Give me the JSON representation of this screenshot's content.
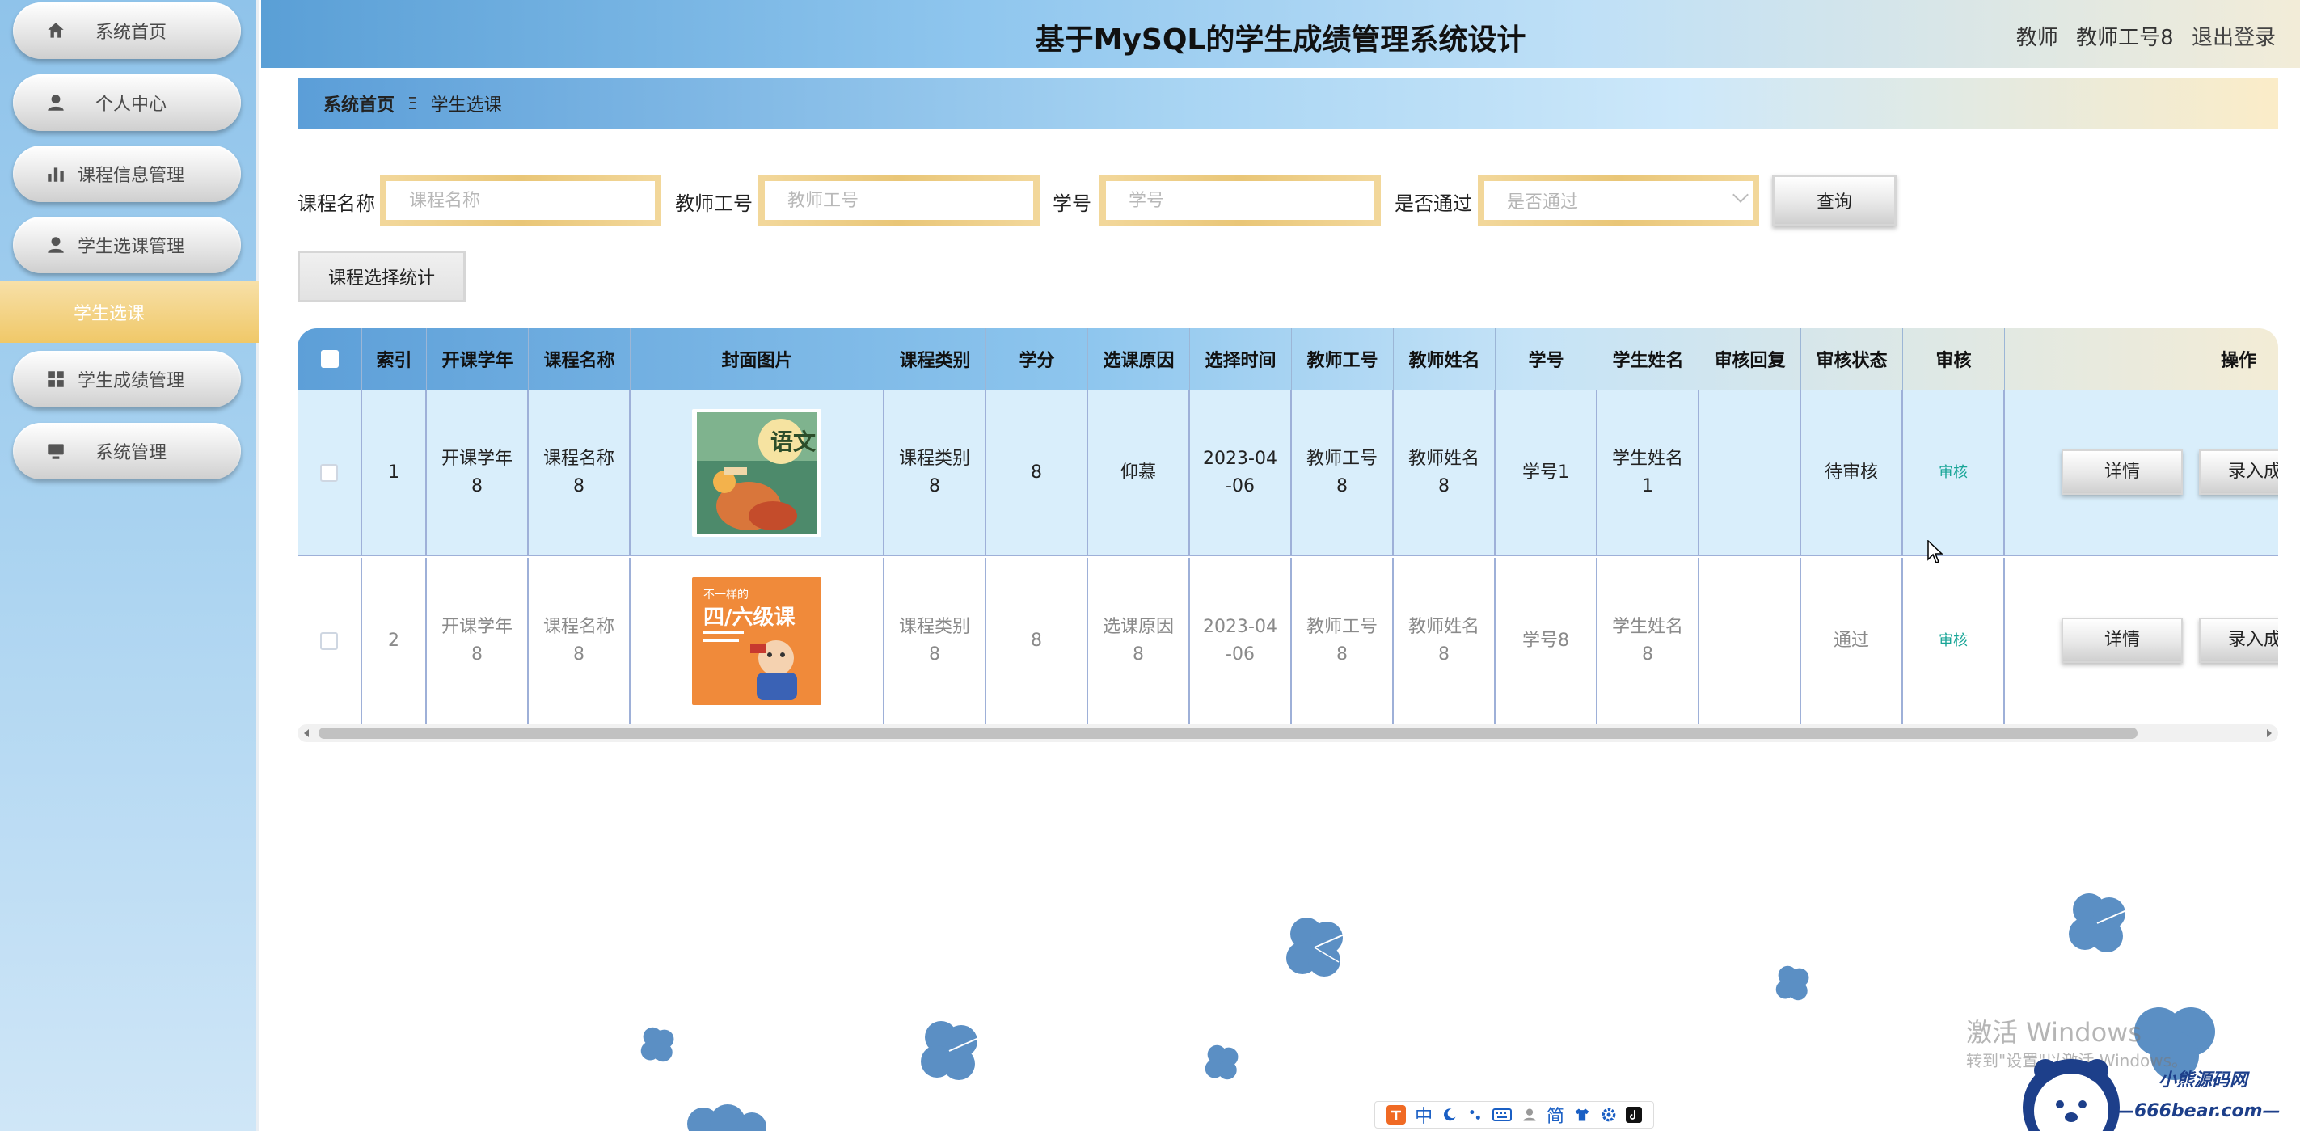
{
  "header": {
    "title": "基于MySQL的学生成绩管理系统设计",
    "role": "教师",
    "user_name": "教师工号8",
    "logout_label": "退出登录"
  },
  "sidebar": {
    "items": [
      {
        "label": "系统首页",
        "icon": "home-icon"
      },
      {
        "label": "个人中心",
        "icon": "user-icon"
      },
      {
        "label": "课程信息管理",
        "icon": "bar-chart-icon"
      },
      {
        "label": "学生选课管理",
        "icon": "user-icon"
      },
      {
        "label": "学生成绩管理",
        "icon": "grid-icon"
      },
      {
        "label": "系统管理",
        "icon": "monitor-icon"
      }
    ],
    "active_sub": "学生选课"
  },
  "breadcrumb": {
    "home": "系统首页",
    "separator": "Ξ",
    "current": "学生选课"
  },
  "search": {
    "course_name_label": "课程名称",
    "course_name_placeholder": "课程名称",
    "teacher_id_label": "教师工号",
    "teacher_id_placeholder": "教师工号",
    "student_id_label": "学号",
    "student_id_placeholder": "学号",
    "passed_label": "是否通过",
    "passed_placeholder": "是否通过",
    "query_button": "查询",
    "stats_button": "课程选择统计"
  },
  "table": {
    "columns": [
      "索引",
      "开课学年",
      "课程名称",
      "封面图片",
      "课程类别",
      "学分",
      "选课原因",
      "选择时间",
      "教师工号",
      "教师姓名",
      "学号",
      "学生姓名",
      "审核回复",
      "审核状态",
      "审核",
      "操作"
    ],
    "rows": [
      {
        "index": "1",
        "year": "开课学年\n8",
        "course_name": "课程名称\n8",
        "cover": "语文",
        "category": "课程类别\n8",
        "credit": "8",
        "reason": "仰慕",
        "time": "2023-04\n-06",
        "teacher_id": "教师工号\n8",
        "teacher_name": "教师姓名\n8",
        "student_id": "学号1",
        "student_name": "学生姓名\n1",
        "reply": "",
        "status": "待审核",
        "audit": "审核",
        "detail_btn": "详情",
        "enter_btn": "录入成绩"
      },
      {
        "index": "2",
        "year": "开课学年\n8",
        "course_name": "课程名称\n8",
        "cover": "四/六级课",
        "category": "课程类别\n8",
        "credit": "8",
        "reason": "选课原因\n8",
        "time": "2023-04\n-06",
        "teacher_id": "教师工号\n8",
        "teacher_name": "教师姓名\n8",
        "student_id": "学号8",
        "student_name": "学生姓名\n8",
        "reply": "",
        "status": "通过",
        "audit": "审核",
        "detail_btn": "详情",
        "enter_btn": "录入成绩"
      }
    ]
  },
  "cover2_top": "不一样的",
  "watermark": {
    "line1": "激活 Windows",
    "line2": "转到\"设置\"以激活 Windows。"
  },
  "ime": [
    "中",
    "简"
  ],
  "brand": {
    "name": "小熊源码网",
    "url": "—666bear.com—"
  },
  "colors": {
    "accent_gold": "#f0c868",
    "header_blue": "#5a9fd6",
    "audit_link": "#18a597"
  }
}
